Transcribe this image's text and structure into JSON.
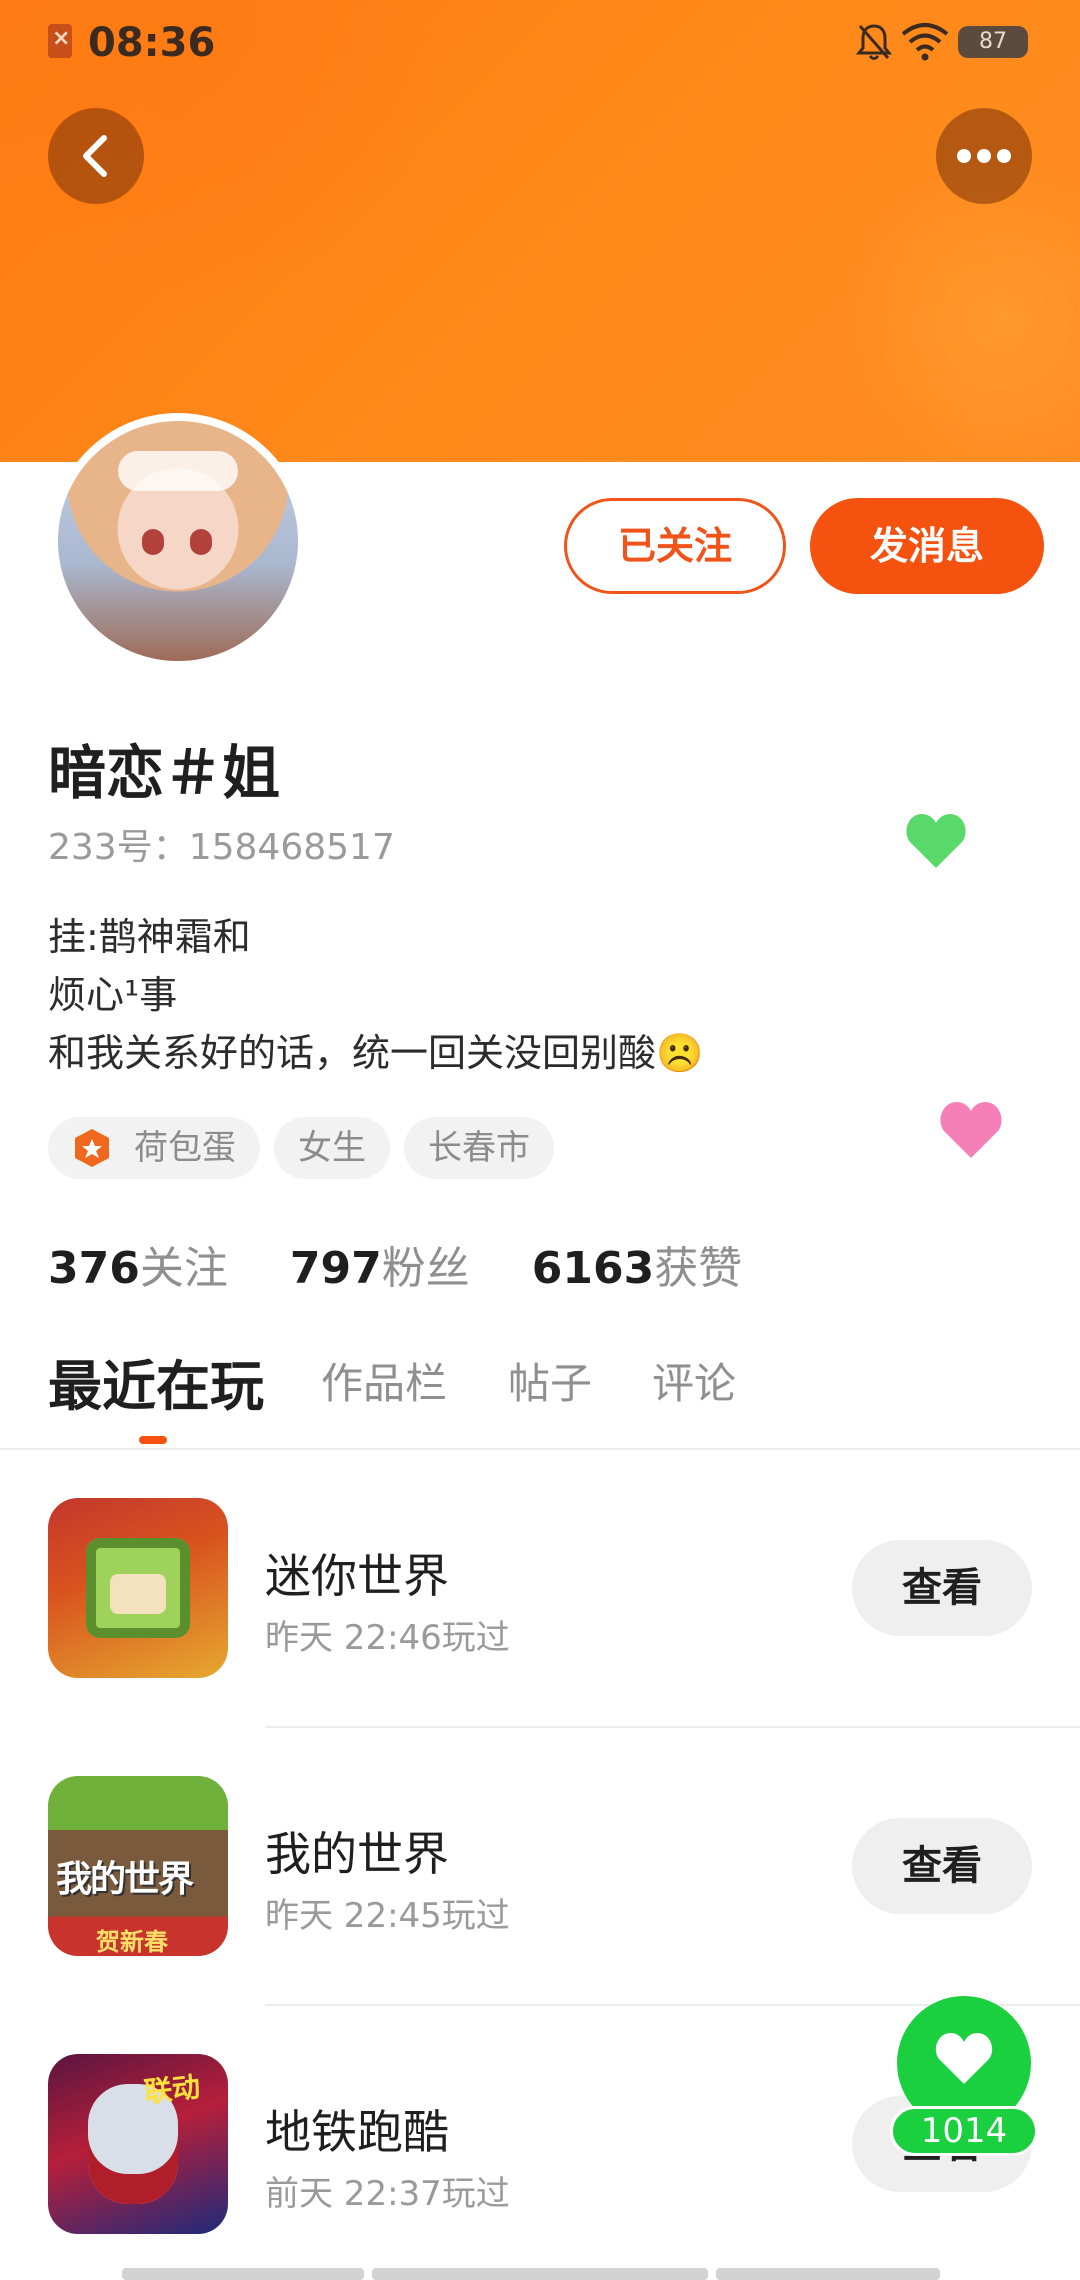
{
  "status_bar": {
    "time": "08:36",
    "battery": "87"
  },
  "actions": {
    "followed_label": "已关注",
    "message_label": "发消息"
  },
  "profile": {
    "username": "暗恋＃姐",
    "id_text": "233号：158468517",
    "bio": [
      "挂:鹊神霜和",
      "烦心¹事",
      "和我关系好的话，统一回关没回别酸☹️"
    ],
    "tags": [
      {
        "label": "荷包蛋",
        "icon": "egg-badge-icon"
      },
      {
        "label": "女生"
      },
      {
        "label": "长春市"
      }
    ]
  },
  "stats": [
    {
      "value": "376",
      "label": "关注"
    },
    {
      "value": "797",
      "label": "粉丝"
    },
    {
      "value": "6163",
      "label": "获赞"
    }
  ],
  "tabs": [
    "最近在玩",
    "作品栏",
    "帖子",
    "评论"
  ],
  "games": [
    {
      "name": "迷你世界",
      "time": "昨天 22:46玩过",
      "button": "查看"
    },
    {
      "name": "我的世界",
      "time": "昨天 22:45玩过",
      "button": "查看"
    },
    {
      "name": "地铁跑酷",
      "time": "前天 22:37玩过",
      "button": "查看"
    }
  ],
  "like_fab": {
    "count": "1014",
    "icon": "heart-icon"
  },
  "colors": {
    "brand_orange": "#f5520f",
    "banner": "#ff8218",
    "like_green": "#1ad03f",
    "heart_pink": "#f57fb6"
  }
}
